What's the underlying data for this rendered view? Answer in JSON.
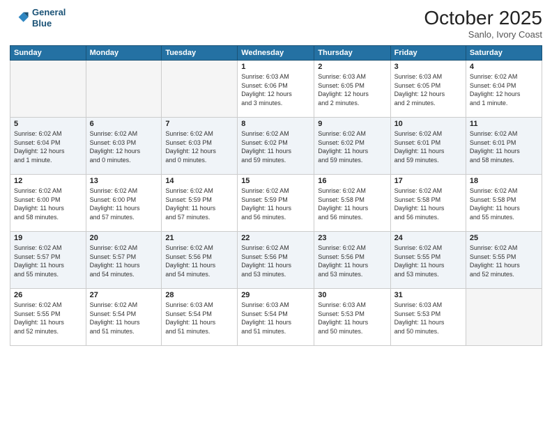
{
  "header": {
    "logo_line1": "General",
    "logo_line2": "Blue",
    "month": "October 2025",
    "location": "Sanlo, Ivory Coast"
  },
  "days_of_week": [
    "Sunday",
    "Monday",
    "Tuesday",
    "Wednesday",
    "Thursday",
    "Friday",
    "Saturday"
  ],
  "weeks": [
    [
      {
        "day": "",
        "info": ""
      },
      {
        "day": "",
        "info": ""
      },
      {
        "day": "",
        "info": ""
      },
      {
        "day": "1",
        "info": "Sunrise: 6:03 AM\nSunset: 6:06 PM\nDaylight: 12 hours\nand 3 minutes."
      },
      {
        "day": "2",
        "info": "Sunrise: 6:03 AM\nSunset: 6:05 PM\nDaylight: 12 hours\nand 2 minutes."
      },
      {
        "day": "3",
        "info": "Sunrise: 6:03 AM\nSunset: 6:05 PM\nDaylight: 12 hours\nand 2 minutes."
      },
      {
        "day": "4",
        "info": "Sunrise: 6:02 AM\nSunset: 6:04 PM\nDaylight: 12 hours\nand 1 minute."
      }
    ],
    [
      {
        "day": "5",
        "info": "Sunrise: 6:02 AM\nSunset: 6:04 PM\nDaylight: 12 hours\nand 1 minute."
      },
      {
        "day": "6",
        "info": "Sunrise: 6:02 AM\nSunset: 6:03 PM\nDaylight: 12 hours\nand 0 minutes."
      },
      {
        "day": "7",
        "info": "Sunrise: 6:02 AM\nSunset: 6:03 PM\nDaylight: 12 hours\nand 0 minutes."
      },
      {
        "day": "8",
        "info": "Sunrise: 6:02 AM\nSunset: 6:02 PM\nDaylight: 11 hours\nand 59 minutes."
      },
      {
        "day": "9",
        "info": "Sunrise: 6:02 AM\nSunset: 6:02 PM\nDaylight: 11 hours\nand 59 minutes."
      },
      {
        "day": "10",
        "info": "Sunrise: 6:02 AM\nSunset: 6:01 PM\nDaylight: 11 hours\nand 59 minutes."
      },
      {
        "day": "11",
        "info": "Sunrise: 6:02 AM\nSunset: 6:01 PM\nDaylight: 11 hours\nand 58 minutes."
      }
    ],
    [
      {
        "day": "12",
        "info": "Sunrise: 6:02 AM\nSunset: 6:00 PM\nDaylight: 11 hours\nand 58 minutes."
      },
      {
        "day": "13",
        "info": "Sunrise: 6:02 AM\nSunset: 6:00 PM\nDaylight: 11 hours\nand 57 minutes."
      },
      {
        "day": "14",
        "info": "Sunrise: 6:02 AM\nSunset: 5:59 PM\nDaylight: 11 hours\nand 57 minutes."
      },
      {
        "day": "15",
        "info": "Sunrise: 6:02 AM\nSunset: 5:59 PM\nDaylight: 11 hours\nand 56 minutes."
      },
      {
        "day": "16",
        "info": "Sunrise: 6:02 AM\nSunset: 5:58 PM\nDaylight: 11 hours\nand 56 minutes."
      },
      {
        "day": "17",
        "info": "Sunrise: 6:02 AM\nSunset: 5:58 PM\nDaylight: 11 hours\nand 56 minutes."
      },
      {
        "day": "18",
        "info": "Sunrise: 6:02 AM\nSunset: 5:58 PM\nDaylight: 11 hours\nand 55 minutes."
      }
    ],
    [
      {
        "day": "19",
        "info": "Sunrise: 6:02 AM\nSunset: 5:57 PM\nDaylight: 11 hours\nand 55 minutes."
      },
      {
        "day": "20",
        "info": "Sunrise: 6:02 AM\nSunset: 5:57 PM\nDaylight: 11 hours\nand 54 minutes."
      },
      {
        "day": "21",
        "info": "Sunrise: 6:02 AM\nSunset: 5:56 PM\nDaylight: 11 hours\nand 54 minutes."
      },
      {
        "day": "22",
        "info": "Sunrise: 6:02 AM\nSunset: 5:56 PM\nDaylight: 11 hours\nand 53 minutes."
      },
      {
        "day": "23",
        "info": "Sunrise: 6:02 AM\nSunset: 5:56 PM\nDaylight: 11 hours\nand 53 minutes."
      },
      {
        "day": "24",
        "info": "Sunrise: 6:02 AM\nSunset: 5:55 PM\nDaylight: 11 hours\nand 53 minutes."
      },
      {
        "day": "25",
        "info": "Sunrise: 6:02 AM\nSunset: 5:55 PM\nDaylight: 11 hours\nand 52 minutes."
      }
    ],
    [
      {
        "day": "26",
        "info": "Sunrise: 6:02 AM\nSunset: 5:55 PM\nDaylight: 11 hours\nand 52 minutes."
      },
      {
        "day": "27",
        "info": "Sunrise: 6:02 AM\nSunset: 5:54 PM\nDaylight: 11 hours\nand 51 minutes."
      },
      {
        "day": "28",
        "info": "Sunrise: 6:03 AM\nSunset: 5:54 PM\nDaylight: 11 hours\nand 51 minutes."
      },
      {
        "day": "29",
        "info": "Sunrise: 6:03 AM\nSunset: 5:54 PM\nDaylight: 11 hours\nand 51 minutes."
      },
      {
        "day": "30",
        "info": "Sunrise: 6:03 AM\nSunset: 5:53 PM\nDaylight: 11 hours\nand 50 minutes."
      },
      {
        "day": "31",
        "info": "Sunrise: 6:03 AM\nSunset: 5:53 PM\nDaylight: 11 hours\nand 50 minutes."
      },
      {
        "day": "",
        "info": ""
      }
    ]
  ]
}
